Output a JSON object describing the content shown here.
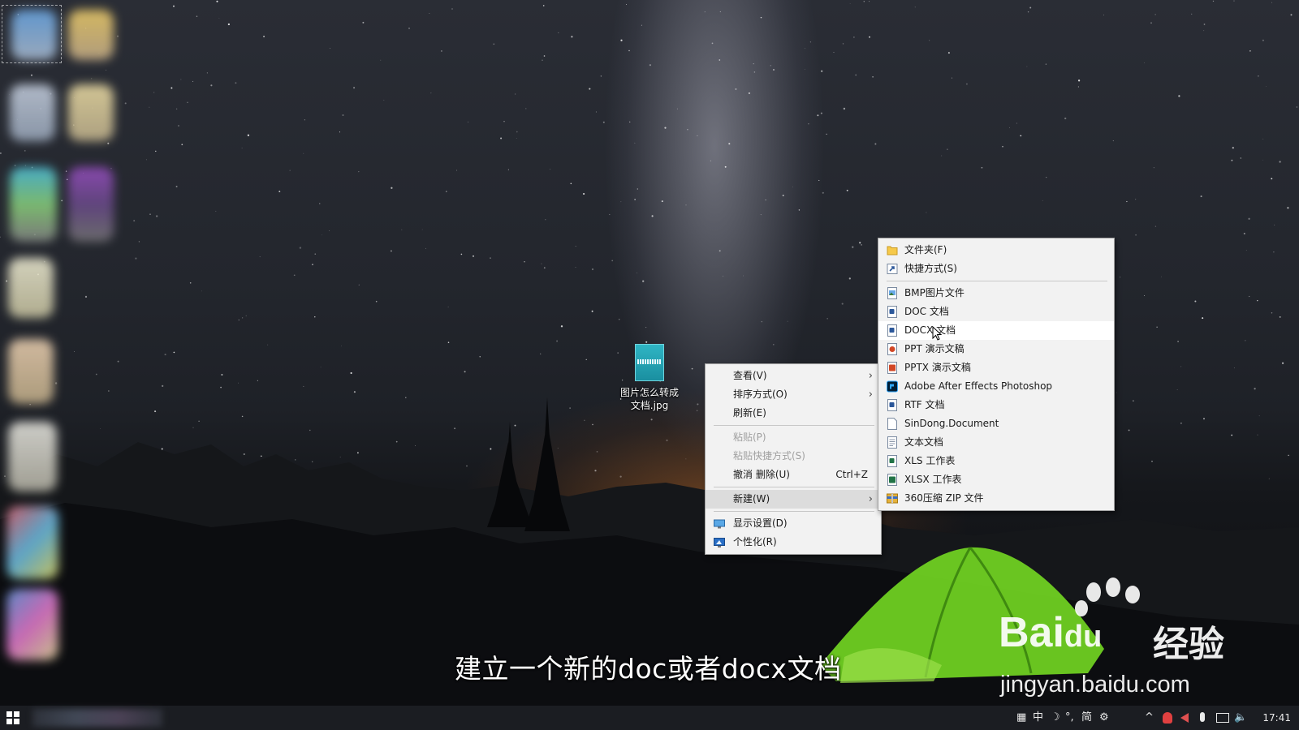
{
  "desktop": {
    "file": {
      "label_line1": "图片怎么转成",
      "label_line2": "文档.jpg",
      "thumb_text": "图片怎么转成文档"
    }
  },
  "context_menu": {
    "items": [
      {
        "label": "查看(V)",
        "has_submenu": true
      },
      {
        "label": "排序方式(O)",
        "has_submenu": true
      },
      {
        "label": "刷新(E)"
      },
      {
        "label": "粘贴(P)",
        "disabled": true
      },
      {
        "label": "粘贴快捷方式(S)",
        "disabled": true
      },
      {
        "label": "撤消 删除(U)",
        "shortcut": "Ctrl+Z"
      },
      {
        "label": "新建(W)",
        "has_submenu": true,
        "active": true
      },
      {
        "label": "显示设置(D)",
        "icon": "display-icon"
      },
      {
        "label": "个性化(R)",
        "icon": "personalize-icon"
      }
    ],
    "arrow": "›"
  },
  "new_submenu": {
    "items": [
      {
        "label": "文件夹(F)",
        "icon": "folder-icon"
      },
      {
        "label": "快捷方式(S)",
        "icon": "shortcut-icon"
      },
      {
        "label": "BMP图片文件",
        "icon": "bmp-file-icon"
      },
      {
        "label": "DOC 文档",
        "icon": "doc-file-icon"
      },
      {
        "label": "DOCX 文档",
        "icon": "docx-file-icon",
        "highlighted": true
      },
      {
        "label": "PPT 演示文稿",
        "icon": "ppt-file-icon"
      },
      {
        "label": "PPTX 演示文稿",
        "icon": "pptx-file-icon"
      },
      {
        "label": "Adobe After Effects Photoshop",
        "icon": "photoshop-icon"
      },
      {
        "label": "RTF 文档",
        "icon": "rtf-file-icon"
      },
      {
        "label": "SinDong.Document",
        "icon": "blank-file-icon"
      },
      {
        "label": "文本文档",
        "icon": "text-file-icon"
      },
      {
        "label": "XLS 工作表",
        "icon": "xls-file-icon"
      },
      {
        "label": "XLSX 工作表",
        "icon": "xlsx-file-icon"
      },
      {
        "label": "360压缩 ZIP 文件",
        "icon": "zip-file-icon"
      }
    ]
  },
  "subtitle": "建立一个新的doc或者docx文档",
  "watermark": {
    "brand": "Bai",
    "brand_du": "du",
    "cn": "经验",
    "url": "jingyan.baidu.com"
  },
  "taskbar": {
    "tray": {
      "ime_grid": "▦",
      "ime_lang": "中",
      "ime_moon": "☽",
      "ime_punct": "°,",
      "ime_simplified": "简",
      "ime_settings": "⚙",
      "chevron": "^",
      "volume": "🔈",
      "clock": "17:41"
    }
  },
  "colors": {
    "menu_bg": "#f2f2f2",
    "menu_active": "#dcdcdc",
    "word_blue": "#2b579a",
    "ppt_orange": "#d24726",
    "excel_green": "#217346",
    "ps_blue": "#001e36",
    "folder_yellow": "#f6c94a"
  }
}
